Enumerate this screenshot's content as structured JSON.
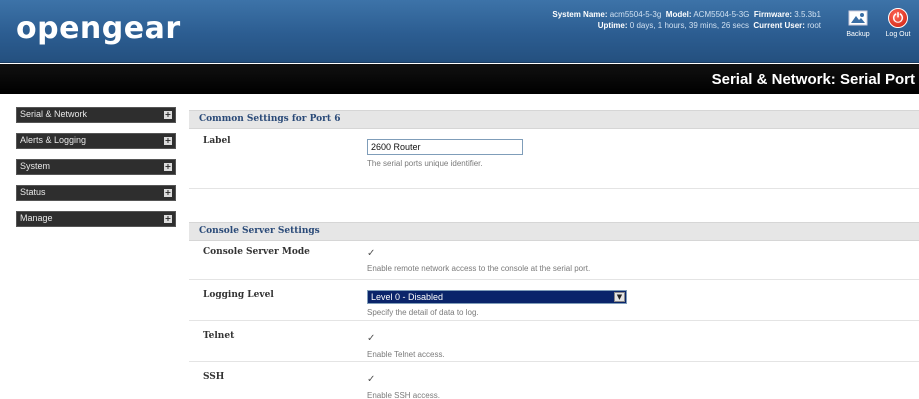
{
  "header": {
    "logo": "opengear",
    "system_name_label": "System Name:",
    "system_name": "acm5504-5-3g",
    "model_label": "Model:",
    "model": "ACM5504-5-3G",
    "firmware_label": "Firmware:",
    "firmware": "3.5.3b1",
    "uptime_label": "Uptime:",
    "uptime": "0 days, 1 hours, 39 mins, 26 secs",
    "current_user_label": "Current User:",
    "current_user": "root",
    "backup_label": "Backup",
    "logout_label": "Log Out",
    "backup_icon": "backup-icon",
    "logout_icon": "power-icon"
  },
  "page_title": "Serial & Network: Serial Port",
  "sidebar": {
    "items": [
      {
        "label": "Serial & Network"
      },
      {
        "label": "Alerts & Logging"
      },
      {
        "label": "System"
      },
      {
        "label": "Status"
      },
      {
        "label": "Manage"
      }
    ],
    "expand_icon": "plus-icon"
  },
  "common_settings": {
    "title": "Common Settings for Port 6",
    "label_field": {
      "label": "Label",
      "value": "2600 Router",
      "hint": "The serial ports unique identifier."
    }
  },
  "console_settings": {
    "title": "Console Server Settings",
    "mode": {
      "label": "Console Server Mode",
      "checked": true,
      "hint": "Enable remote network access to the console at the serial port."
    },
    "logging": {
      "label": "Logging Level",
      "value": "Level 0 - Disabled",
      "hint": "Specify the detail of data to log."
    },
    "telnet": {
      "label": "Telnet",
      "checked": true,
      "hint": "Enable Telnet access."
    },
    "ssh": {
      "label": "SSH",
      "checked": true,
      "hint": "Enable SSH access."
    }
  },
  "colors": {
    "header_blue": "#2c5d91",
    "title_bar": "#000000",
    "section_title": "#2a4a78",
    "select_highlight": "#0a246a"
  }
}
